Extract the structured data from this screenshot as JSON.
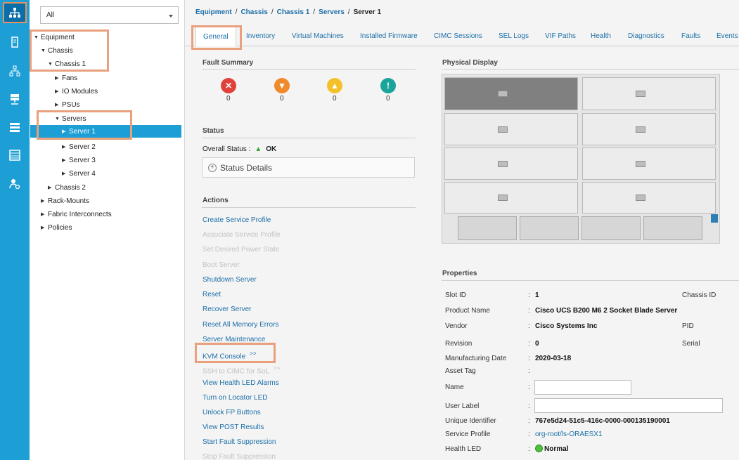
{
  "rail": {
    "items": [
      {
        "icon": "equipment-icon",
        "active": true
      },
      {
        "icon": "server-icon"
      },
      {
        "icon": "network-icon"
      },
      {
        "icon": "san-icon"
      },
      {
        "icon": "vm-icon"
      },
      {
        "icon": "storage-icon"
      },
      {
        "icon": "admin-icon"
      }
    ]
  },
  "filter": {
    "value": "All"
  },
  "tree": {
    "items": [
      {
        "label": "Equipment",
        "level": 0,
        "expanded": true
      },
      {
        "label": "Chassis",
        "level": 1,
        "expanded": true
      },
      {
        "label": "Chassis 1",
        "level": 2,
        "expanded": true
      },
      {
        "label": "Fans",
        "level": 3,
        "expanded": false
      },
      {
        "label": "IO Modules",
        "level": 3,
        "expanded": false
      },
      {
        "label": "PSUs",
        "level": 3,
        "expanded": false
      },
      {
        "label": "Servers",
        "level": 3,
        "expanded": true
      },
      {
        "label": "Server 1",
        "level": 4,
        "expanded": false,
        "selected": true
      },
      {
        "label": "Server 2",
        "level": 4,
        "expanded": false
      },
      {
        "label": "Server 3",
        "level": 4,
        "expanded": false
      },
      {
        "label": "Server 4",
        "level": 4,
        "expanded": false
      },
      {
        "label": "Chassis 2",
        "level": 2,
        "expanded": false
      },
      {
        "label": "Rack-Mounts",
        "level": 1,
        "expanded": false
      },
      {
        "label": "Fabric Interconnects",
        "level": 1,
        "expanded": false
      },
      {
        "label": "Policies",
        "level": 1,
        "expanded": false
      }
    ]
  },
  "breadcrumb": {
    "items": [
      "Equipment",
      "Chassis",
      "Chassis 1",
      "Servers"
    ],
    "current": "Server 1"
  },
  "tabs": [
    "General",
    "Inventory",
    "Virtual Machines",
    "Installed Firmware",
    "CIMC Sessions",
    "SEL Logs",
    "VIF Paths",
    "Health",
    "Diagnostics",
    "Faults",
    "Events"
  ],
  "fault_summary": {
    "title": "Fault Summary",
    "items": [
      {
        "severity": "critical",
        "count": "0",
        "color": "#e0413a"
      },
      {
        "severity": "major",
        "count": "0",
        "color": "#f08a2b"
      },
      {
        "severity": "minor",
        "count": "0",
        "color": "#f4c12a"
      },
      {
        "severity": "warning",
        "count": "0",
        "color": "#1aa49c"
      }
    ]
  },
  "status": {
    "title": "Status",
    "overall_label": "Overall Status :",
    "overall_value": "OK",
    "details_label": "Status Details"
  },
  "actions": {
    "title": "Actions",
    "items": [
      {
        "label": "Create Service Profile",
        "enabled": true
      },
      {
        "label": "Associate Service Profile",
        "enabled": false
      },
      {
        "label": "Set Desired Power State",
        "enabled": false
      },
      {
        "label": "Boot Server",
        "enabled": false
      },
      {
        "label": "Shutdown Server",
        "enabled": true
      },
      {
        "label": "Reset",
        "enabled": true
      },
      {
        "label": "Recover Server",
        "enabled": true
      },
      {
        "label": "Reset All Memory Errors",
        "enabled": true
      },
      {
        "label": "Server Maintenance",
        "enabled": true
      },
      {
        "label": "KVM Console",
        "suffix": ">>",
        "enabled": true
      },
      {
        "label": "SSH to CIMC for SoL",
        "suffix": ">>",
        "enabled": false
      },
      {
        "label": "View Health LED Alarms",
        "enabled": true
      },
      {
        "label": "Turn on Locator LED",
        "enabled": true
      },
      {
        "label": "Unlock FP Buttons",
        "enabled": true
      },
      {
        "label": "View POST Results",
        "enabled": true
      },
      {
        "label": "Start Fault Suppression",
        "enabled": true
      },
      {
        "label": "Stop Fault Suppression",
        "enabled": false
      }
    ]
  },
  "physical_display": {
    "title": "Physical Display"
  },
  "properties": {
    "title": "Properties",
    "slot_id_label": "Slot ID",
    "slot_id": "1",
    "chassis_id_label": "Chassis ID",
    "product_name_label": "Product Name",
    "product_name": "Cisco UCS B200 M6 2 Socket Blade Server",
    "vendor_label": "Vendor",
    "vendor": "Cisco Systems Inc",
    "pid_label": "PID",
    "revision_label": "Revision",
    "revision": "0",
    "serial_label": "Serial",
    "manufacturing_date_label": "Manufacturing Date",
    "manufacturing_date": "2020-03-18",
    "asset_tag_label": "Asset Tag",
    "name_label": "Name",
    "name_value": "",
    "user_label_label": "User Label",
    "user_label_value": "",
    "uuid_label": "Unique Identifier",
    "uuid": "767e5d24-51c5-416c-0000-000135190001",
    "service_profile_label": "Service Profile",
    "service_profile": "org-root/ls-ORAESX1",
    "health_led_label": "Health LED",
    "health_led": "Normal"
  },
  "colors": {
    "accent": "#1d9fd6",
    "highlight": "#e9a07c",
    "link": "#1c6fa8"
  }
}
